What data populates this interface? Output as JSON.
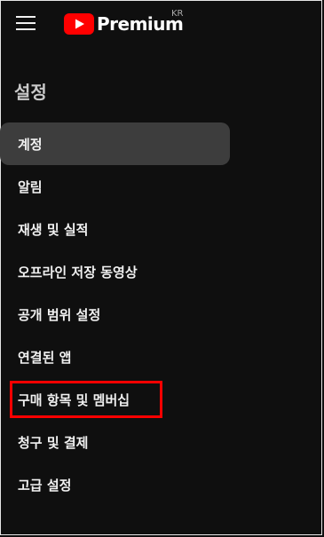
{
  "header": {
    "brand": "Premium",
    "country": "KR"
  },
  "section_title": "설정",
  "nav": {
    "items": [
      {
        "label": "계정",
        "active": true
      },
      {
        "label": "알림"
      },
      {
        "label": "재생 및 실적"
      },
      {
        "label": "오프라인 저장 동영상"
      },
      {
        "label": "공개 범위 설정"
      },
      {
        "label": "연결된 앱"
      },
      {
        "label": "구매 항목 및 멤버십",
        "highlighted": true
      },
      {
        "label": "청구 및 결제"
      },
      {
        "label": "고급 설정"
      }
    ]
  },
  "colors": {
    "background": "#0f0f0f",
    "active_item": "#3d3d3d",
    "highlight_box": "#ff0000",
    "brand_red": "#ff0000"
  }
}
